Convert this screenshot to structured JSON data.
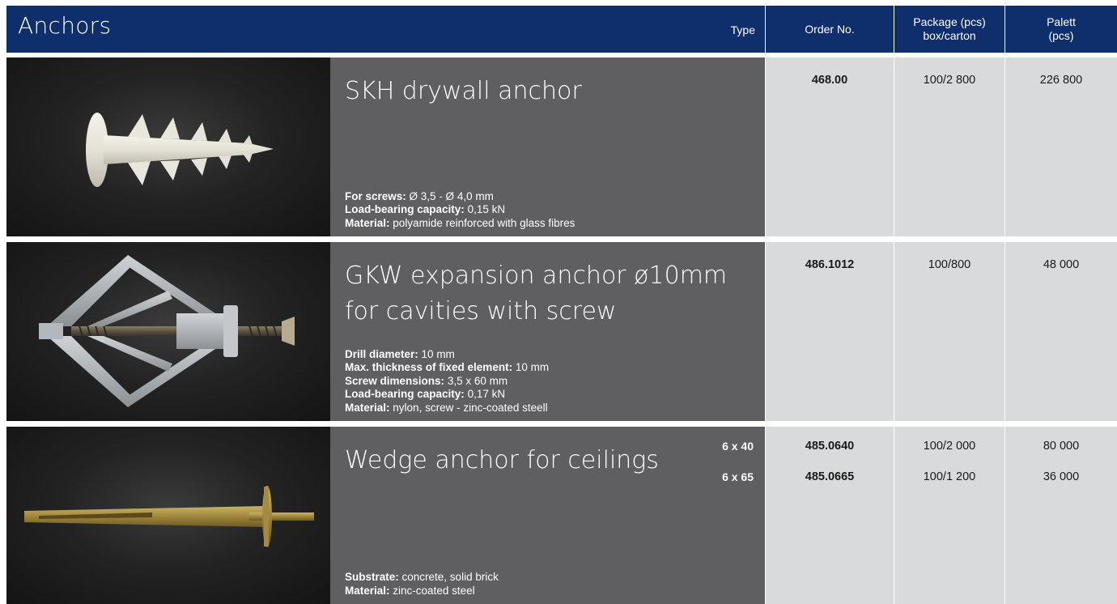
{
  "header": {
    "title": "Anchors",
    "type_label": "Type",
    "order_label": "Order No.",
    "package_line1": "Package (pcs)",
    "package_line2": "box/carton",
    "palett_line1": "Palett",
    "palett_line2": "(pcs)"
  },
  "colors": {
    "header_blue": "#0f2e6c",
    "description_gray": "#5f5f61",
    "table_gray": "#d9dadb"
  },
  "products": [
    {
      "name": "SKH drywall anchor",
      "image_icon": "drywall-anchor-photo",
      "specs": [
        {
          "label": "For screws:",
          "value": "Ø 3,5 - Ø 4,0 mm"
        },
        {
          "label": "Load-bearing capacity:",
          "value": "0,15 kN"
        },
        {
          "label": "Material:",
          "value": "polyamide reinforced with glass fibres"
        }
      ],
      "variants": [
        {
          "type": "",
          "order_no": "468.00",
          "package": "100/2 800",
          "palett": "226 800"
        }
      ]
    },
    {
      "name": "GKW expansion anchor ø10mm for cavities with screw",
      "image_icon": "expansion-anchor-photo",
      "specs": [
        {
          "label": "Drill diameter:",
          "value": "10 mm"
        },
        {
          "label": "Max. thickness of fixed element:",
          "value": "10 mm"
        },
        {
          "label": "Screw dimensions:",
          "value": "3,5 x 60 mm"
        },
        {
          "label": "Load-bearing capacity:",
          "value": "0,17 kN"
        },
        {
          "label": "Material:",
          "value": "nylon, screw - zinc-coated steell"
        }
      ],
      "variants": [
        {
          "type": "",
          "order_no": "486.1012",
          "package": "100/800",
          "palett": "48 000"
        }
      ]
    },
    {
      "name": "Wedge anchor for ceilings",
      "image_icon": "wedge-anchor-photo",
      "specs": [
        {
          "label": "Substrate:",
          "value": "concrete, solid brick"
        },
        {
          "label": "Material:",
          "value": "zinc-coated steel"
        }
      ],
      "variants": [
        {
          "type": "6 x 40",
          "order_no": "485.0640",
          "package": "100/2 000",
          "palett": "80 000"
        },
        {
          "type": "6 x 65",
          "order_no": "485.0665",
          "package": "100/1 200",
          "palett": "36 000"
        }
      ]
    }
  ]
}
